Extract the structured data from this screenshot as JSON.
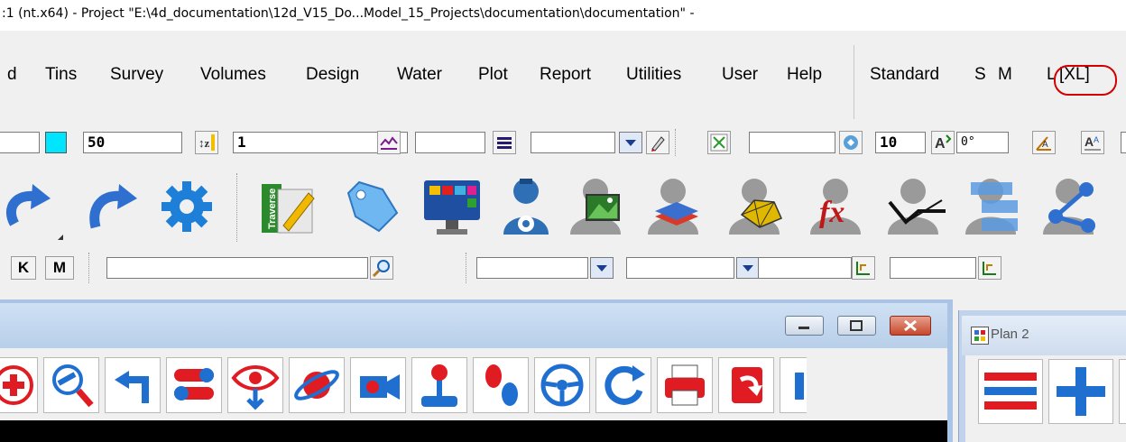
{
  "window": {
    "title": ":1 (nt.x64) - Project \"E:\\4d_documentation\\12d_V15_Do...Model_15_Projects\\documentation\\documentation\" -"
  },
  "menubar": {
    "items": [
      "d",
      "Tins",
      "Survey",
      "Volumes",
      "Design",
      "Water",
      "Plot",
      "Report",
      "Utilities",
      "User",
      "Help"
    ],
    "sizes": [
      "Standard",
      "S",
      "M",
      "L",
      "[XL]"
    ]
  },
  "toolbar1": {
    "field_width_value": "50",
    "field_z_value": "1",
    "field_text_value": "10",
    "field_angle_value": "0°",
    "colour_swatch": "#00e5ff"
  },
  "toolbar3": {
    "k_label": "K",
    "m_label": "M",
    "search_value": ""
  },
  "subwindow": {
    "icons": [
      "add-circle-icon",
      "zoom-icon",
      "undo-arrow-icon",
      "toggle-icon",
      "eye-down-icon",
      "planet-icon",
      "video-camera-icon",
      "joystick-icon",
      "footsteps-icon",
      "steering-wheel-icon",
      "refresh-icon",
      "printer-icon",
      "copy-arrow-icon"
    ]
  },
  "plan": {
    "title": "Plan 2"
  },
  "colors": {
    "highlight_ring": "#d20000",
    "accent_blue": "#1f6fd1",
    "accent_red": "#e11b22"
  }
}
